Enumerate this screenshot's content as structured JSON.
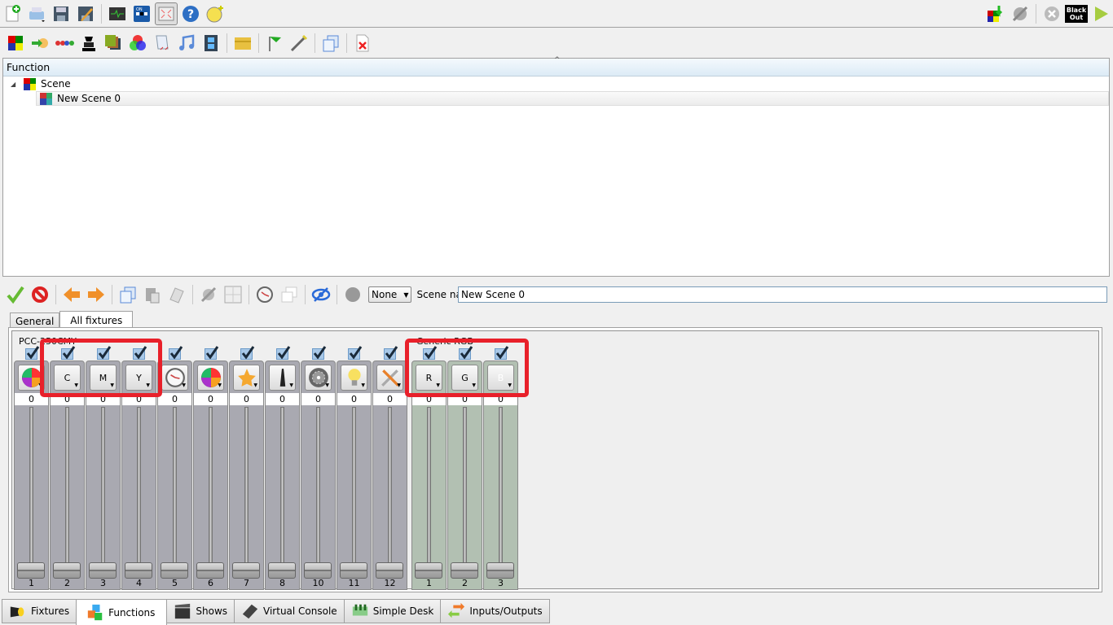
{
  "toolbar_main": {
    "left_icons": [
      "new-workspace-icon",
      "open-workspace-icon",
      "save-icon",
      "save-as-icon",
      "monitor-icon",
      "dmx-dump-icon",
      "fullscreen-icon",
      "help-icon",
      "address-tool-icon"
    ],
    "right_icons": [
      "fixture-import-icon",
      "disable-live-edit-icon",
      "stop-all-icon",
      "blackout-icon",
      "operate-mode-icon"
    ],
    "blackout_label_line1": "Black",
    "blackout_label_line2": "Out"
  },
  "toolbar_functions": {
    "icons": [
      "add-scene-icon",
      "add-chaser-icon",
      "add-sequence-icon",
      "add-efx-icon",
      "add-collection-icon",
      "add-rgb-matrix-icon",
      "add-script-icon",
      "add-audio-icon",
      "add-video-icon",
      "add-folder-icon",
      "wizard-icon",
      "autostart-icon",
      "clone-icon",
      "delete-icon"
    ]
  },
  "function_tree": {
    "header": "Function",
    "items": [
      {
        "label": "Scene",
        "expanded": true,
        "children": [
          {
            "label": "New Scene 0",
            "selected": true
          }
        ]
      }
    ]
  },
  "scene_editor": {
    "toolbar_icons": [
      "enable-all-icon",
      "disable-all-icon",
      "previous-icon",
      "next-icon",
      "copy-icon",
      "paste-icon",
      "copy-to-all-icon",
      "color-tool-icon",
      "position-tool-icon",
      "speed-dial-icon",
      "tabbed-view-icon",
      "blind-icon",
      "recording-icon"
    ],
    "speed_combo": "None",
    "scene_name_label": "Scene name:",
    "scene_name_value": "New Scene 0",
    "tabs": [
      {
        "label": "General",
        "active": false
      },
      {
        "label": "All fixtures",
        "active": true
      }
    ]
  },
  "fixture_groups": [
    {
      "name": "PCC-250CMY",
      "channels": [
        {
          "icon": "color-wheel-icon",
          "label": "",
          "value": 0,
          "number": "1",
          "checked": true
        },
        {
          "icon": "",
          "label": "C",
          "value": 0,
          "number": "2",
          "checked": true
        },
        {
          "icon": "",
          "label": "M",
          "value": 0,
          "number": "3",
          "checked": true
        },
        {
          "icon": "",
          "label": "Y",
          "value": 0,
          "number": "4",
          "checked": true
        },
        {
          "icon": "clock-icon",
          "label": "",
          "value": 0,
          "number": "5",
          "checked": true
        },
        {
          "icon": "color-wheel-icon",
          "label": "",
          "value": 0,
          "number": "6",
          "checked": true
        },
        {
          "icon": "star-gobo-icon",
          "label": "",
          "value": 0,
          "number": "7",
          "checked": true
        },
        {
          "icon": "beam-icon",
          "label": "",
          "value": 0,
          "number": "8",
          "checked": true
        },
        {
          "icon": "shutter-icon",
          "label": "",
          "value": 0,
          "number": "10",
          "checked": true
        },
        {
          "icon": "lightbulb-icon",
          "label": "",
          "value": 0,
          "number": "11",
          "checked": true
        },
        {
          "icon": "tools-icon",
          "label": "",
          "value": 0,
          "number": "12",
          "checked": true
        }
      ]
    },
    {
      "name": "Generic RGB",
      "channels": [
        {
          "icon": "",
          "label": "R",
          "value": 0,
          "number": "1",
          "checked": true
        },
        {
          "icon": "",
          "label": "G",
          "value": 0,
          "number": "2",
          "checked": true
        },
        {
          "icon": "",
          "label": "B",
          "value": 0,
          "number": "3",
          "checked": true
        }
      ]
    }
  ],
  "bottom_tabs": [
    {
      "label": "Fixtures",
      "icon": "spotlight-icon",
      "active": false
    },
    {
      "label": "Functions",
      "icon": "functions-cubes-icon",
      "active": true
    },
    {
      "label": "Shows",
      "icon": "clapperboard-icon",
      "active": false
    },
    {
      "label": "Virtual Console",
      "icon": "console-icon",
      "active": false
    },
    {
      "label": "Simple Desk",
      "icon": "sliders-icon",
      "active": false
    },
    {
      "label": "Inputs/Outputs",
      "icon": "io-arrows-icon",
      "active": false
    }
  ],
  "colors": {
    "highlight_annotation": "#e8202a",
    "rgb_group_bg": "#b2c0b2",
    "channel_bg": "#a9a9b1"
  }
}
